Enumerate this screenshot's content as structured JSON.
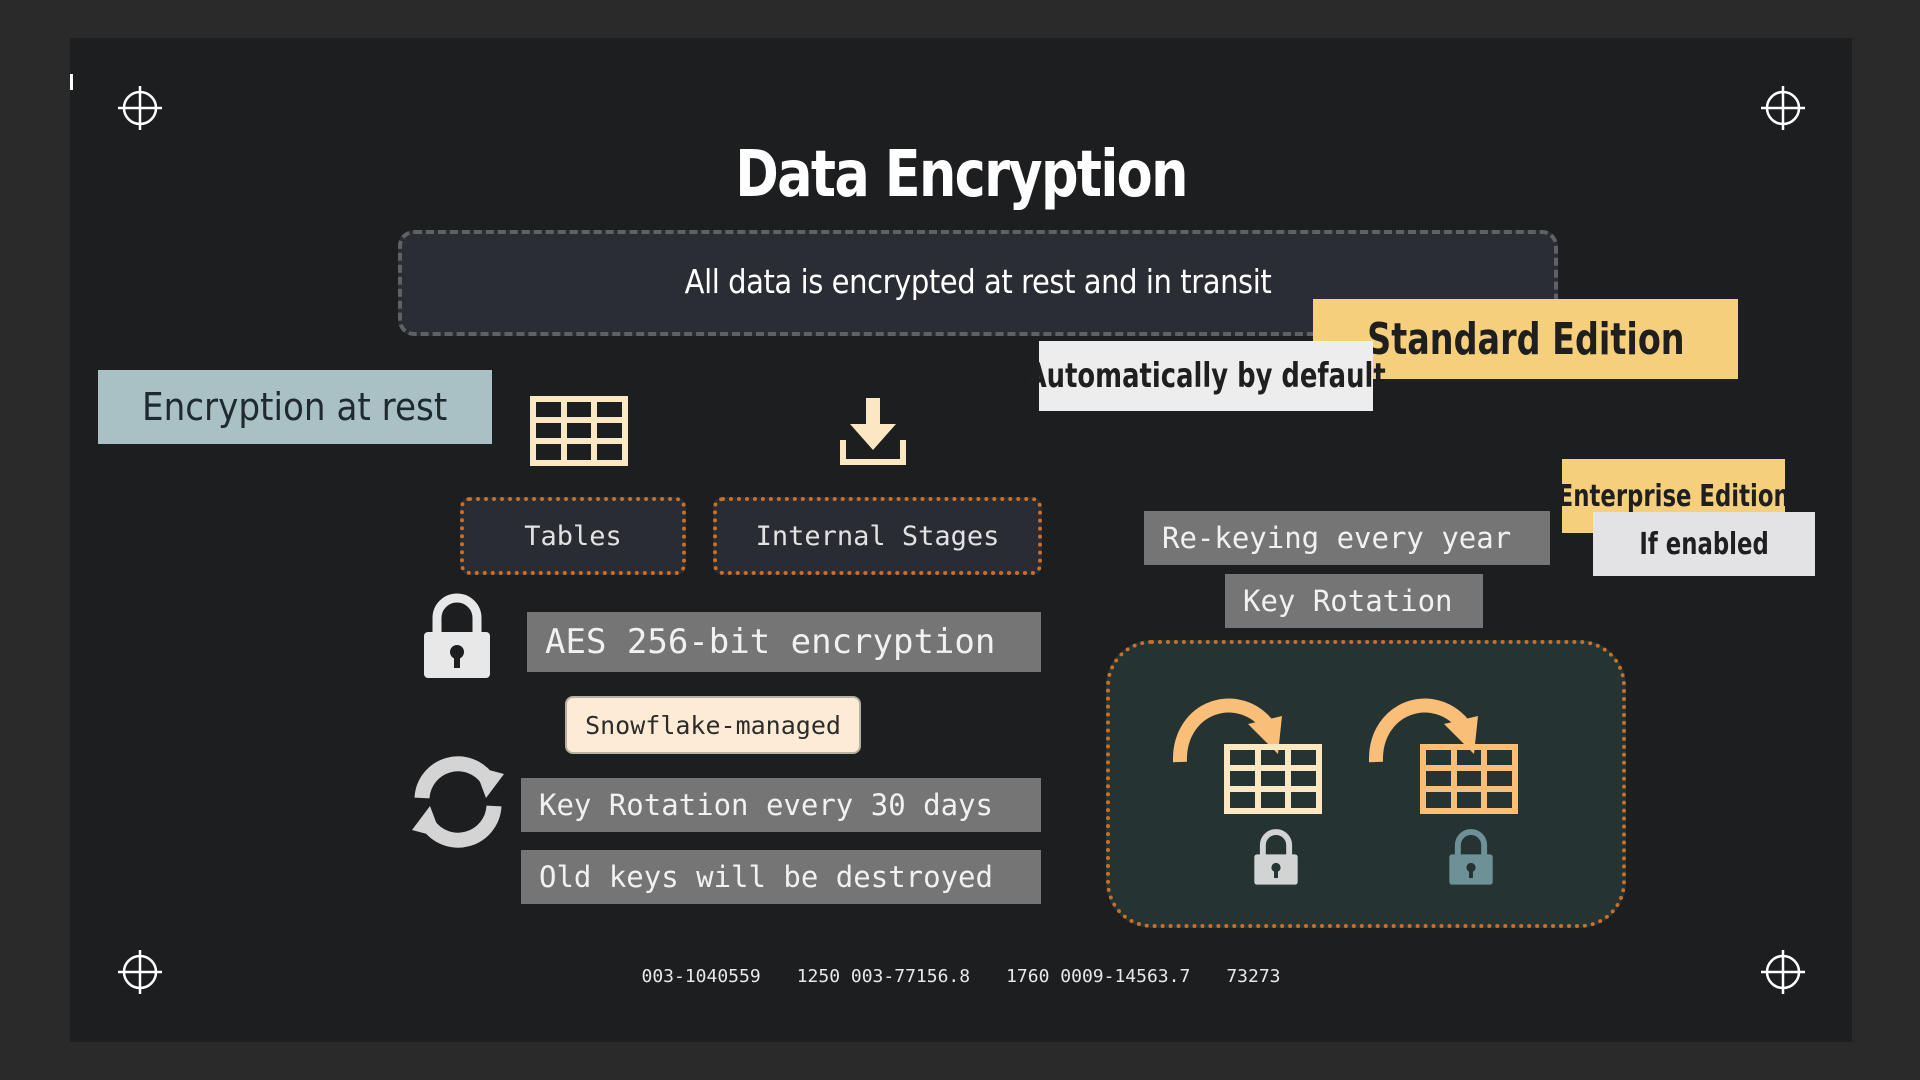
{
  "title": "Data Encryption",
  "banner": "All data is encrypted at rest and in transit",
  "encryption_at_rest": "Encryption at rest",
  "standard_edition": "Standard Edition",
  "auto_default": "Automatically by default",
  "enterprise_edition": "Enterprise Edition",
  "if_enabled": "If enabled",
  "tables": "Tables",
  "internal_stages": "Internal Stages",
  "aes": "AES 256-bit encryption",
  "snowflake_managed": "Snowflake-managed",
  "key_rotation_30": "Key Rotation every 30 days",
  "old_keys": "Old keys will be destroyed",
  "rekeying": "Re-keying every year",
  "key_rotation": "Key Rotation",
  "footer": [
    "003-1040559",
    "1250 003-77156.8",
    "1760 0009-14563.7",
    "73273"
  ],
  "colors": {
    "background": "#1d1e20",
    "gold": "#f6cf7c",
    "slate_tag": "#a9c0c5",
    "light_tag": "#e8e8ea",
    "gray_box": "#757575",
    "dotted_orange": "#c8702a",
    "cream_icon": "#fbe7c1",
    "arrow_orange": "#f9be78",
    "teal_panel": "#263333",
    "teal_lock": "#6e9197"
  },
  "icons": [
    "crosshair-icon",
    "table-icon",
    "download-icon",
    "lock-icon",
    "refresh-icon",
    "curved-arrow-icon"
  ]
}
